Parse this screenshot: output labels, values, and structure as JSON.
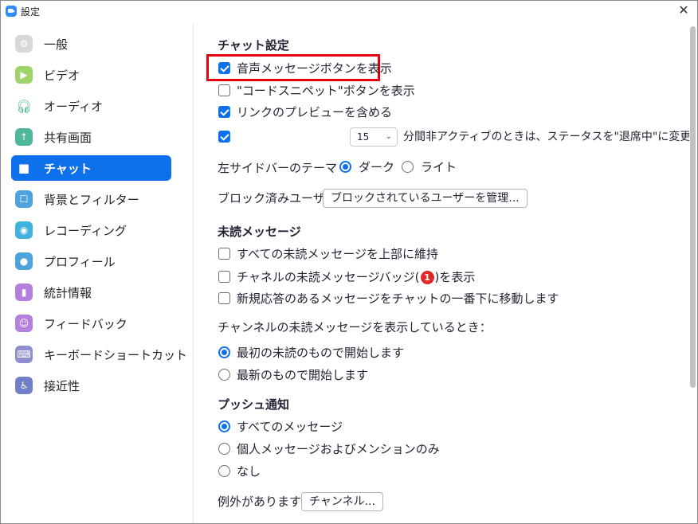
{
  "window": {
    "title": "設定"
  },
  "sidebar": {
    "items": [
      {
        "label": "一般",
        "icon": "gear-icon",
        "color": "#dcdcdc"
      },
      {
        "label": "ビデオ",
        "icon": "video-camera-icon",
        "color": "#9ed46a"
      },
      {
        "label": "オーディオ",
        "icon": "headphones-icon",
        "color": "#4fb89a"
      },
      {
        "label": "共有画面",
        "icon": "share-screen-icon",
        "color": "#4fb89a"
      },
      {
        "label": "チャット",
        "icon": "chat-bubble-icon",
        "color": "#ffffff"
      },
      {
        "label": "背景とフィルター",
        "icon": "background-icon",
        "color": "#4fa3dd"
      },
      {
        "label": "レコーディング",
        "icon": "record-icon",
        "color": "#3fb2dd"
      },
      {
        "label": "プロフィール",
        "icon": "profile-icon",
        "color": "#4fa3dd"
      },
      {
        "label": "統計情報",
        "icon": "statistics-icon",
        "color": "#b57fdc"
      },
      {
        "label": "フィードバック",
        "icon": "feedback-smile-icon",
        "color": "#b57fdc"
      },
      {
        "label": "キーボードショートカット",
        "icon": "keyboard-icon",
        "color": "#8f8fd0"
      },
      {
        "label": "接近性",
        "icon": "accessibility-icon",
        "color": "#6f7fc8"
      }
    ],
    "active_index": 4,
    "accent": "#0e71eb"
  },
  "chat": {
    "section_title": "チャット設定",
    "voice_message_button": "音声メッセージボタンを表示",
    "code_snippet_button": "\"コードスニペット\"ボタンを表示",
    "link_preview": "リンクのプレビューを含める",
    "idle_minutes": "15",
    "idle_text": "分間非アクティブのときは、ステータスを\"退席中\"に変更する",
    "theme_label": "左サイドバーのテーマ",
    "theme_dark": "ダーク",
    "theme_light": "ライト",
    "blocked_label": "ブロック済みユーザー",
    "blocked_button": "ブロックされているユーザーを管理..."
  },
  "unread": {
    "section_title": "未読メッセージ",
    "keep_top": "すべての未読メッセージを上部に維持",
    "badge_before": "チャネルの未読メッセージバッジ(",
    "badge_count": "1",
    "badge_after": ")を表示",
    "move_bottom": "新規応答のあるメッセージをチャットの一番下に移動します",
    "when_label": "チャンネルの未読メッセージを表示しているとき：",
    "start_oldest": "最初の未読のもので開始します",
    "start_newest": "最新のもので開始します"
  },
  "push": {
    "section_title": "プッシュ通知",
    "all": "すべてのメッセージ",
    "private": "個人メッセージおよびメンションのみ",
    "none": "なし",
    "exception_label": "例外があります",
    "channel_button": "チャンネル..."
  }
}
